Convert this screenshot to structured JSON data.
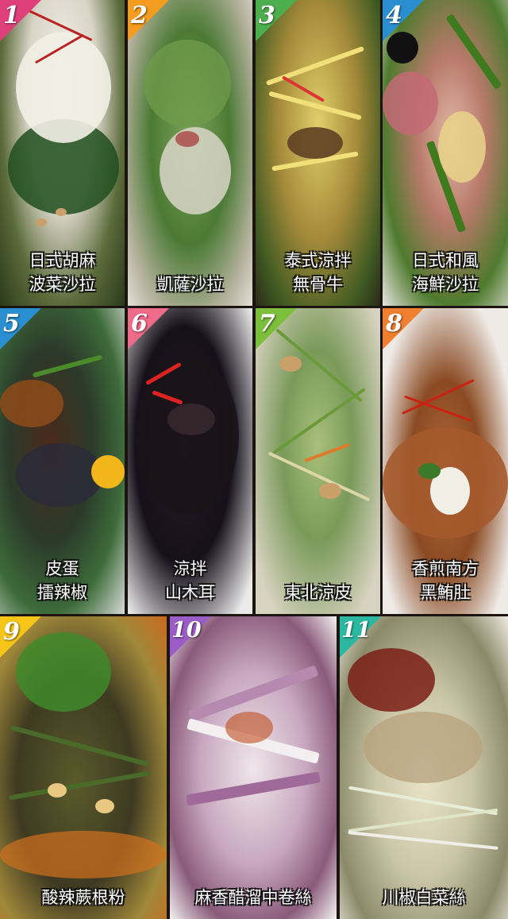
{
  "dishes": [
    {
      "number": "1",
      "badge_color": "#e0407a",
      "lines": [
        "日式胡麻",
        "波菜沙拉"
      ]
    },
    {
      "number": "2",
      "badge_color": "#f39c1f",
      "lines": [
        "凱薩沙拉"
      ]
    },
    {
      "number": "3",
      "badge_color": "#4cae4c",
      "lines": [
        "泰式涼拌",
        "無骨牛"
      ]
    },
    {
      "number": "4",
      "badge_color": "#2a8fd0",
      "lines": [
        "日式和風",
        "海鮮沙拉"
      ]
    },
    {
      "number": "5",
      "badge_color": "#2a8fd0",
      "lines": [
        "皮蛋",
        "擂辣椒"
      ]
    },
    {
      "number": "6",
      "badge_color": "#f06a8a",
      "lines": [
        "涼拌",
        "山木耳"
      ]
    },
    {
      "number": "7",
      "badge_color": "#7bbf3a",
      "lines": [
        "東北涼皮"
      ]
    },
    {
      "number": "8",
      "badge_color": "#f08030",
      "lines": [
        "香煎南方",
        "黑鮪肚"
      ]
    },
    {
      "number": "9",
      "badge_color": "#f5c518",
      "lines": [
        "酸辣蕨根粉"
      ]
    },
    {
      "number": "10",
      "badge_color": "#9a5cc7",
      "lines": [
        "麻香醋溜中卷絲"
      ]
    },
    {
      "number": "11",
      "badge_color": "#2ab8a0",
      "lines": [
        "川椒白菜絲"
      ]
    }
  ]
}
